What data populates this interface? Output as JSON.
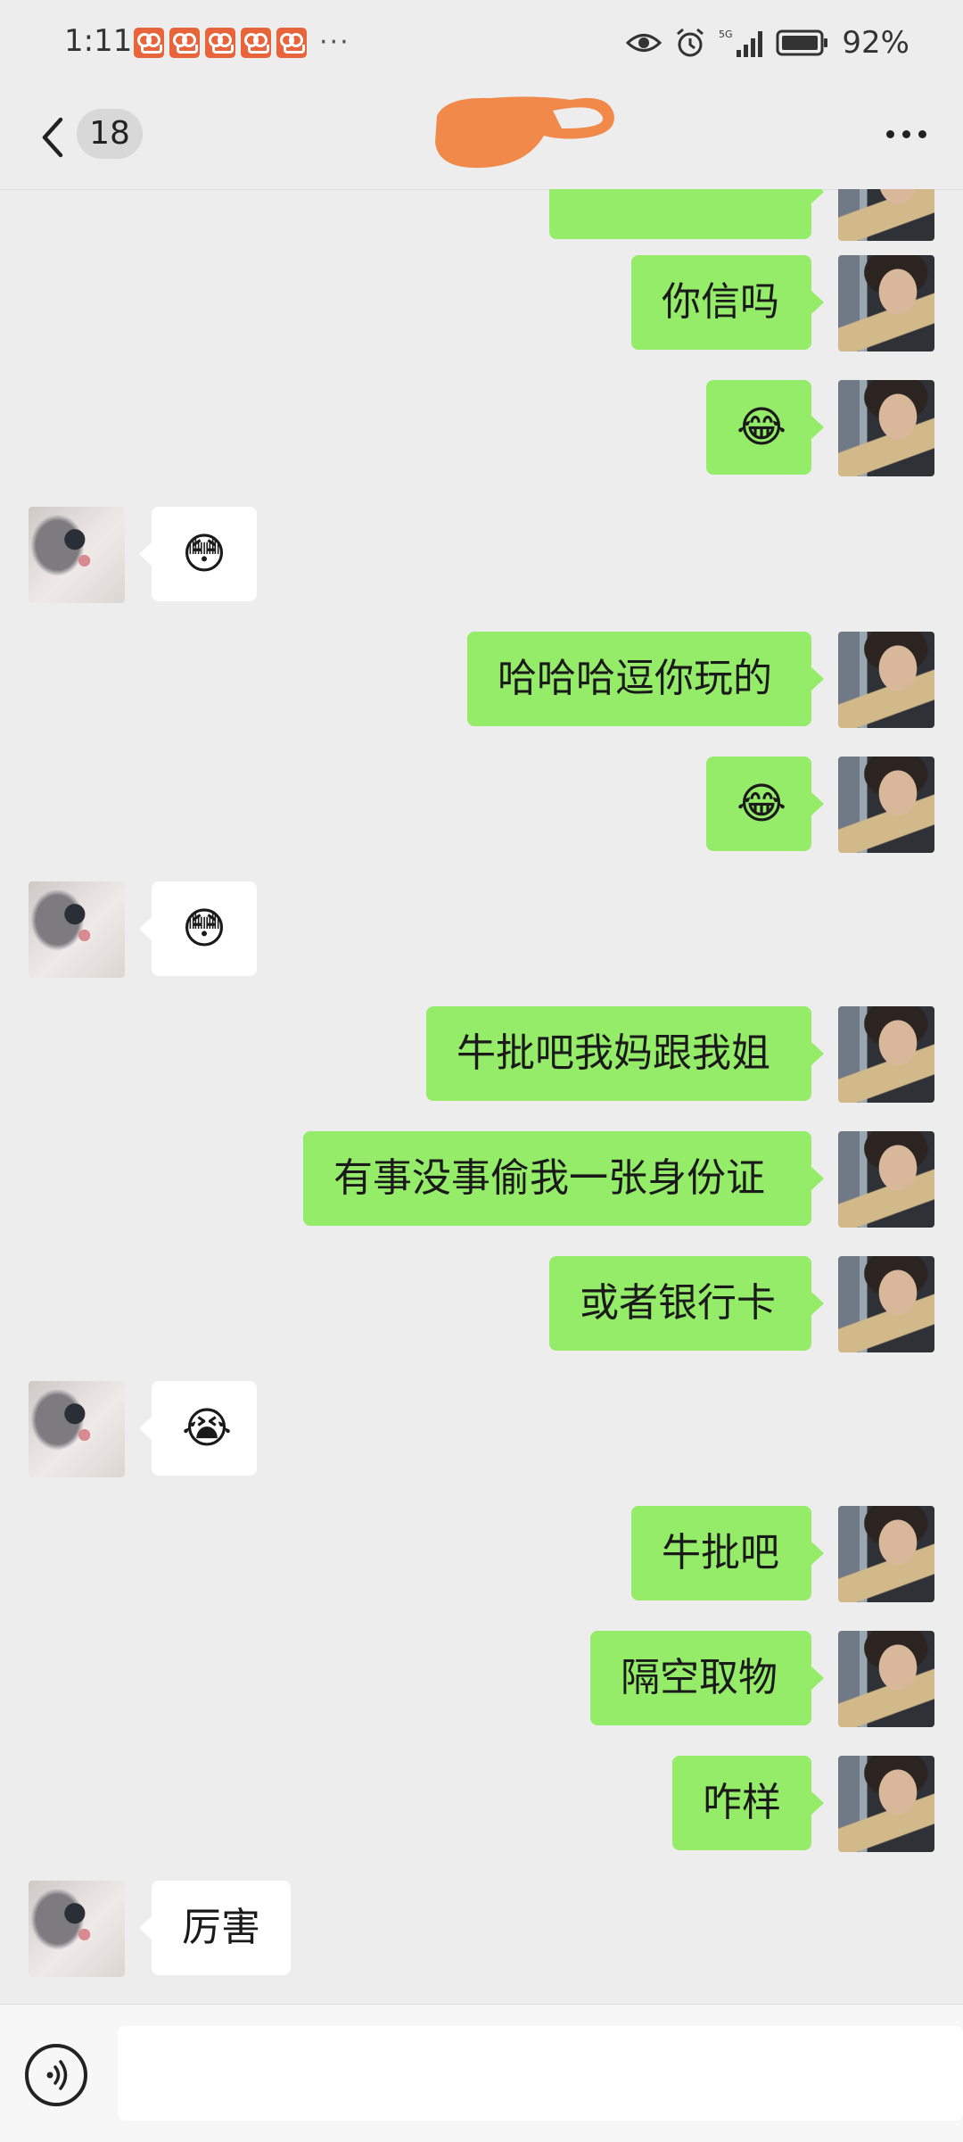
{
  "status_bar": {
    "time": "1:11",
    "more_indicator": "···",
    "battery_percent": "92%",
    "network_label": "5G"
  },
  "header": {
    "unread_count": "18"
  },
  "messages": [
    {
      "from": "me",
      "text": "你信吗"
    },
    {
      "from": "me",
      "text": "😂"
    },
    {
      "from": "other",
      "text": "😳"
    },
    {
      "from": "me",
      "text": "哈哈哈逗你玩的"
    },
    {
      "from": "me",
      "text": "😂"
    },
    {
      "from": "other",
      "text": "😳"
    },
    {
      "from": "me",
      "text": "牛批吧我妈跟我姐"
    },
    {
      "from": "me",
      "text": "有事没事偷我一张身份证"
    },
    {
      "from": "me",
      "text": "或者银行卡"
    },
    {
      "from": "other",
      "text": "😭"
    },
    {
      "from": "me",
      "text": "牛批吧"
    },
    {
      "from": "me",
      "text": "隔空取物"
    },
    {
      "from": "me",
      "text": "咋样"
    },
    {
      "from": "other",
      "text": "厉害"
    }
  ],
  "input": {
    "value": "",
    "placeholder": ""
  },
  "colors": {
    "my_bubble": "#95ec69",
    "other_bubble": "#ffffff",
    "background": "#ededed",
    "notif_app": "#e8643a",
    "redaction": "#f0894a"
  }
}
